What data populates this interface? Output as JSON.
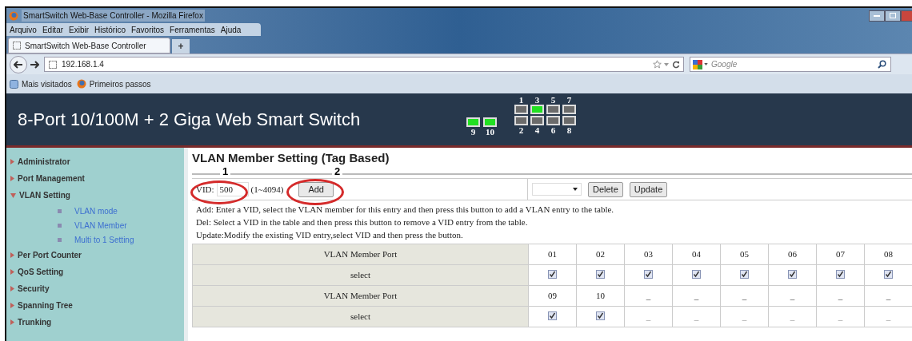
{
  "window": {
    "title": "SmartSwitch Web-Base Controller - Mozilla Firefox"
  },
  "menu_bar": [
    "Arquivo",
    "Editar",
    "Exibir",
    "Histórico",
    "Favoritos",
    "Ferramentas",
    "Ajuda"
  ],
  "tabs": [
    {
      "label": "SmartSwitch Web-Base Controller",
      "selected": true
    }
  ],
  "new_tab": "+",
  "address": "192.168.1.4",
  "search": {
    "placeholder": "Google"
  },
  "bookmarks": [
    "Mais visitados",
    "Primeiros passos"
  ],
  "banner": {
    "title": "8-Port 10/100M + 2 Giga Web Smart Switch",
    "ports_top": [
      {
        "label": "1",
        "link": false
      },
      {
        "label": "3",
        "link": true
      },
      {
        "label": "5",
        "link": false
      },
      {
        "label": "7",
        "link": false
      }
    ],
    "ports_bottom": [
      {
        "label": "2",
        "link": false
      },
      {
        "label": "4",
        "link": false
      },
      {
        "label": "6",
        "link": false
      },
      {
        "label": "8",
        "link": false
      }
    ],
    "ports_giga": [
      {
        "label": "9",
        "link": true
      },
      {
        "label": "10",
        "link": true
      }
    ]
  },
  "sidebar": {
    "items": [
      {
        "label": "Administrator",
        "expanded": false
      },
      {
        "label": "Port Management",
        "expanded": false
      },
      {
        "label": "VLAN Setting",
        "expanded": true,
        "children": [
          {
            "label": "VLAN mode"
          },
          {
            "label": "VLAN Member"
          },
          {
            "label": "Multi to 1 Setting"
          }
        ]
      },
      {
        "label": "Per Port Counter",
        "expanded": false
      },
      {
        "label": "QoS Setting",
        "expanded": false
      },
      {
        "label": "Security",
        "expanded": false
      },
      {
        "label": "Spanning Tree",
        "expanded": false
      },
      {
        "label": "Trunking",
        "expanded": false
      }
    ]
  },
  "page": {
    "heading": "VLAN Member Setting (Tag Based)",
    "annotations": [
      "1",
      "2"
    ],
    "vid_label": "VID:",
    "vid_value": "500",
    "vid_range": "(1~4094)",
    "add_button": "Add",
    "delete_button": "Delete",
    "update_button": "Update",
    "help": [
      "Add: Enter a VID, select the VLAN member for this entry and then press this button to add a VLAN entry to the table.",
      "Del: Select a VID in the table and then press this button to remove a VID entry from the table.",
      "Update:Modify the existing VID entry,select VID and then press the button."
    ],
    "table": {
      "rows": [
        {
          "kind": "ports",
          "label": "VLAN Member Port",
          "cells": [
            "01",
            "02",
            "03",
            "04",
            "05",
            "06",
            "07",
            "08"
          ]
        },
        {
          "kind": "select",
          "label": "select",
          "cells": [
            {
              "checked": true
            },
            {
              "checked": true
            },
            {
              "checked": true
            },
            {
              "checked": true
            },
            {
              "checked": true
            },
            {
              "checked": true
            },
            {
              "checked": true
            },
            {
              "checked": true
            }
          ]
        },
        {
          "kind": "ports",
          "label": "VLAN Member Port",
          "cells": [
            "09",
            "10",
            "_",
            "_",
            "_",
            "_",
            "_",
            "_"
          ]
        },
        {
          "kind": "select",
          "label": "select",
          "cells": [
            {
              "checked": true
            },
            {
              "checked": true
            },
            {
              "empty": "_"
            },
            {
              "empty": "_"
            },
            {
              "empty": "_"
            },
            {
              "empty": "_"
            },
            {
              "empty": "_"
            },
            {
              "empty": "_"
            }
          ]
        }
      ]
    }
  }
}
